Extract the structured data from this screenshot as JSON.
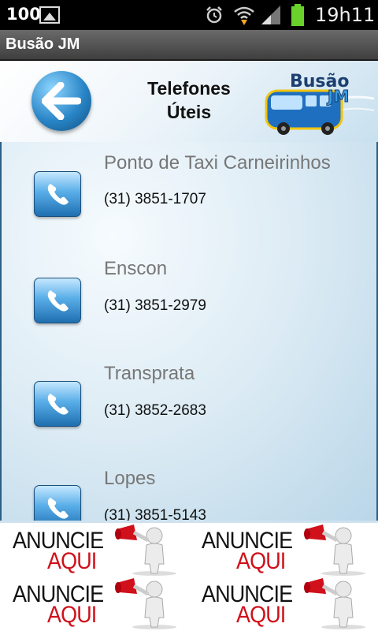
{
  "status_bar": {
    "battery_text": "100",
    "time": "19h11",
    "icons": [
      "gallery-icon",
      "alarm-icon",
      "wifi-icon",
      "signal-icon",
      "battery-icon"
    ],
    "battery_color": "#6ad12a"
  },
  "app": {
    "title": "Busão JM"
  },
  "header": {
    "title_line1": "Telefones",
    "title_line2": "Úteis",
    "logo_text_line1": "Busão",
    "logo_text_line2": "JM",
    "back_icon": "arrow-left-icon"
  },
  "contacts": [
    {
      "name": "Ponto de Taxi Carneirinhos",
      "phone": "(31) 3851-1707"
    },
    {
      "name": "Enscon",
      "phone": "(31) 3851-2979"
    },
    {
      "name": "Transprata",
      "phone": "(31) 3852-2683"
    },
    {
      "name": "Lopes",
      "phone": "(31) 3851-5143"
    }
  ],
  "ads": [
    {
      "line1": "ANUNCIE",
      "line2": "AQUI"
    },
    {
      "line1": "ANUNCIE",
      "line2": "AQUI"
    },
    {
      "line1": "ANUNCIE",
      "line2": "AQUI"
    },
    {
      "line1": "ANUNCIE",
      "line2": "AQUI"
    }
  ],
  "colors": {
    "accent_blue": "#2a86c7",
    "ad_red": "#d0101a"
  }
}
